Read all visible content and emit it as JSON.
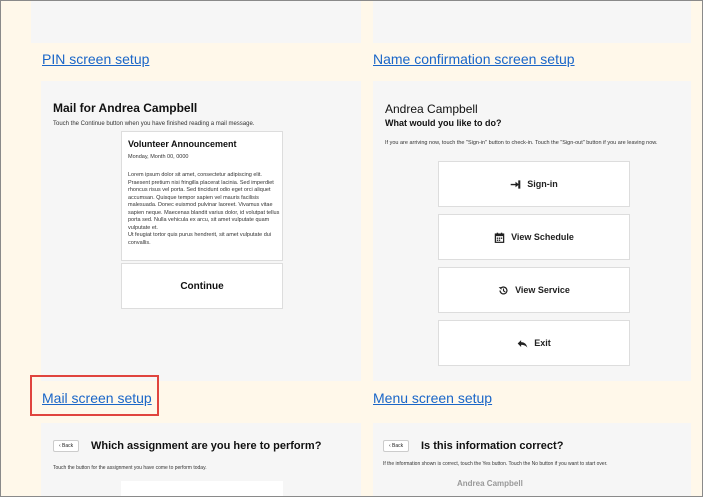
{
  "top_links": {
    "pin": "PIN screen setup",
    "name_confirm": "Name confirmation screen setup"
  },
  "mail_card": {
    "title": "Mail for Andrea Campbell",
    "subtitle": "Touch the Continue button when you have finished reading a mail message.",
    "message": {
      "title": "Volunteer Announcement",
      "date": "Monday, Month 00, 0000",
      "body1": "Lorem ipsum dolor sit amet, consectetur adipiscing elit. Praesent pretium nisi fringilla placerat lacinia. Sed imperdiet rhoncus risus vel porta. Sed tincidunt odio eget orci aliquet accumsan. Quisque tempor sapien vel mauris facilisis malesuada. Donec euismod pulvinar laoreet. Vivamus vitae sapien neque. Maecenas blandit varius dolor, id volutpat tellus porta sed. Nulla vehicula ex arcu, sit amet vulputate quam vulputate et.",
      "body2": "Ut feugiat tortor quis purus hendrerit, sit amet vulputate dui convallis."
    },
    "continue_label": "Continue"
  },
  "menu_card": {
    "name": "Andrea Campbell",
    "question": "What would you like to do?",
    "instructions": "If you are arriving now, touch the \"Sign-in\" button to check-in. Touch the \"Sign-out\" button if you are leaving now.",
    "buttons": [
      {
        "label": "Sign-in",
        "icon": "sign-in-icon"
      },
      {
        "label": "View Schedule",
        "icon": "calendar-icon"
      },
      {
        "label": "View Service",
        "icon": "history-icon"
      },
      {
        "label": "Exit",
        "icon": "reply-icon"
      }
    ]
  },
  "section_links": {
    "mail": "Mail screen setup",
    "menu": "Menu screen setup"
  },
  "assignment_card": {
    "back_label": "‹ Back",
    "title": "Which assignment are you here to perform?",
    "instructions": "Touch the button for the assignment you have come to perform today."
  },
  "confirm_card": {
    "back_label": "‹ Back",
    "title": "Is this information correct?",
    "instructions": "If the information shown is correct, touch the Yes button. Touch the No button if you want to start over.",
    "name": "Andrea Campbell"
  },
  "colors": {
    "background": "#fff8ea",
    "link": "#1a66c8",
    "highlight": "#e0443e"
  }
}
